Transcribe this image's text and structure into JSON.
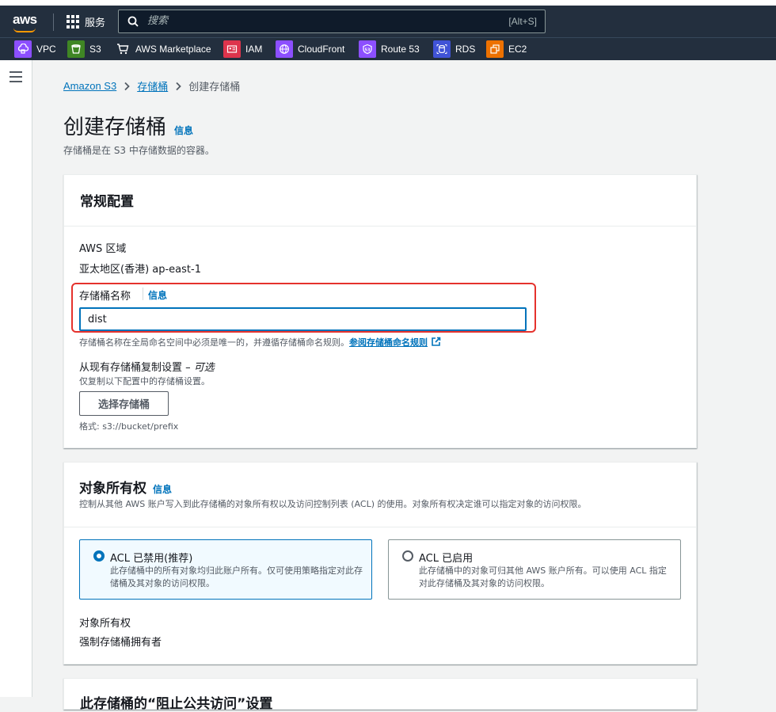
{
  "topbar": {
    "logo_text": "aws",
    "services_label": "服务",
    "search_placeholder": "搜索",
    "search_shortcut": "[Alt+S]"
  },
  "favorites": [
    {
      "label": "VPC",
      "color": "#8c4fff"
    },
    {
      "label": "S3",
      "color": "#3f8624"
    },
    {
      "label": "AWS Marketplace",
      "color": "#232f3e"
    },
    {
      "label": "IAM",
      "color": "#dd344c"
    },
    {
      "label": "CloudFront",
      "color": "#8c4fff"
    },
    {
      "label": "Route 53",
      "color": "#8c4fff"
    },
    {
      "label": "RDS",
      "color": "#4053d6"
    },
    {
      "label": "EC2",
      "color": "#ed7100"
    }
  ],
  "breadcrumb": {
    "root": "Amazon S3",
    "parent": "存储桶",
    "current": "创建存储桶"
  },
  "page": {
    "title": "创建存储桶",
    "info": "信息",
    "description": "存储桶是在 S3 中存储数据的容器。"
  },
  "general": {
    "title": "常规配置",
    "region_label": "AWS 区域",
    "region_value": "亚太地区(香港) ap-east-1",
    "name_label": "存储桶名称",
    "name_info": "信息",
    "name_value": "dist",
    "name_hint": "存储桶名称在全局命名空间中必须是唯一的，并遵循存储桶命名规则。",
    "name_rules_link": "参阅存储桶命名规则",
    "copy_label": "从现有存储桶复制设置 – ",
    "copy_optional": "可选",
    "copy_hint": "仅复制以下配置中的存储桶设置。",
    "choose_button": "选择存储桶",
    "format_hint": "格式: s3://bucket/prefix"
  },
  "ownership": {
    "title": "对象所有权",
    "info": "信息",
    "description": "控制从其他 AWS 账户写入到此存储桶的对象所有权以及访问控制列表 (ACL) 的使用。对象所有权决定谁可以指定对象的访问权限。",
    "option1_title": "ACL 已禁用(推荐)",
    "option1_desc": "此存储桶中的所有对象均归此账户所有。仅可使用策略指定对此存储桶及其对象的访问权限。",
    "option2_title": "ACL 已启用",
    "option2_desc": "此存储桶中的对象可归其他 AWS 账户所有。可以使用 ACL 指定对此存储桶及其对象的访问权限。",
    "owner_label": "对象所有权",
    "owner_value": "强制存储桶拥有者"
  },
  "next_panel": {
    "title": "此存储桶的“阻止公共访问”设置"
  }
}
